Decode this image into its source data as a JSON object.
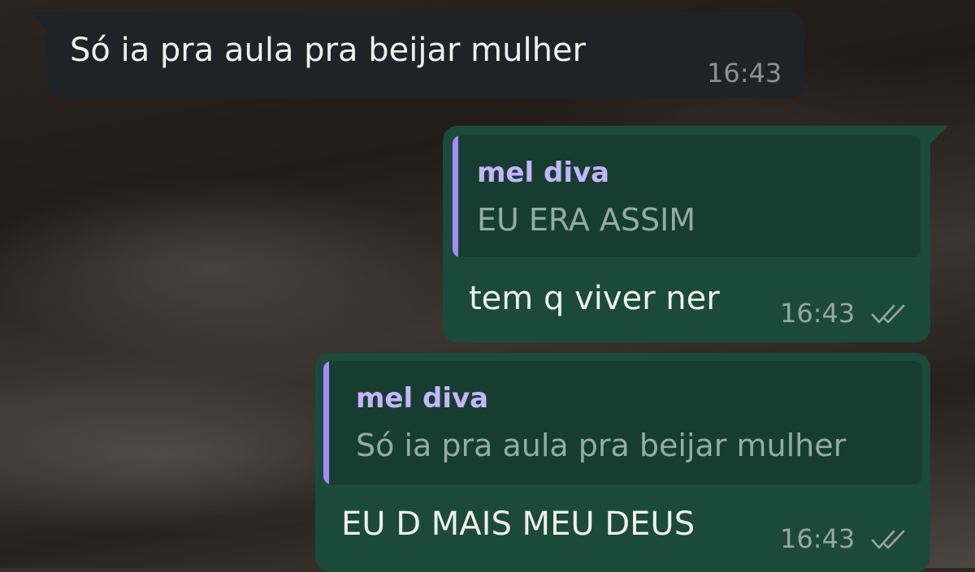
{
  "messages": [
    {
      "direction": "incoming",
      "text": "Só ia pra aula pra beijar mulher",
      "time": "16:43"
    },
    {
      "direction": "outgoing",
      "reply_to": {
        "author": "mel diva",
        "text": "EU ERA ASSIM"
      },
      "text": "tem q viver ner",
      "time": "16:43",
      "status_icon": "double-check-icon"
    },
    {
      "direction": "outgoing",
      "reply_to": {
        "author": "mel diva",
        "text": "Só ia pra aula pra beijar mulher"
      },
      "text": "EU D MAIS MEU DEUS",
      "time": "16:43",
      "status_icon": "double-check-icon"
    }
  ],
  "colors": {
    "incoming_bubble": "#1f2327",
    "outgoing_bubble": "#1c4a3a",
    "quote_accent": "#a78bfa",
    "quote_author": "#c4b5fd"
  }
}
